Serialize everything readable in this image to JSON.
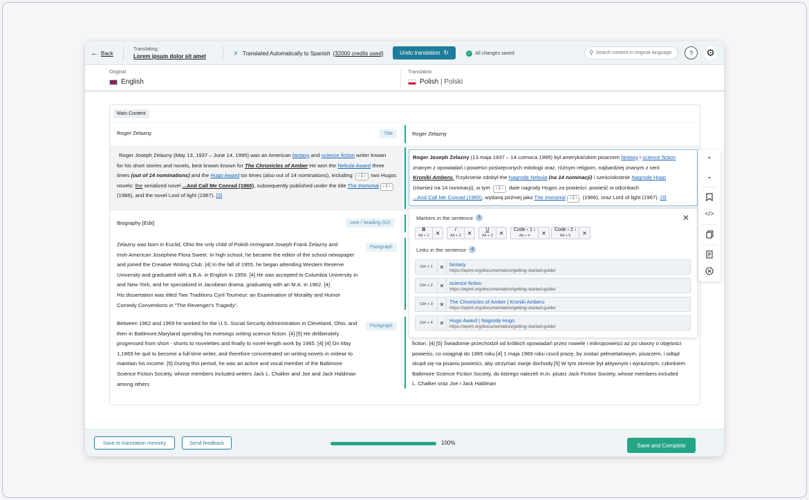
{
  "topbar": {
    "back_label": "Back",
    "translating_label": "Translating:",
    "document_title": "Lorem ipsum dolor sit amet",
    "auto_text": "Translated Automatically to Spanish",
    "credits_text": "(32000 credits used)",
    "undo_label": "Undo translation",
    "saved_text": "All changes saved",
    "search_placeholder": "Search content in original language"
  },
  "languages": {
    "original_caption": "Original",
    "original_name": "English",
    "translation_caption": "Translation",
    "translation_name": "Polish",
    "translation_native": "| Polski"
  },
  "content": {
    "section_tag": "Main Content",
    "title_row": {
      "source": "Roger Zelazny",
      "tag": "Title",
      "target": "Roger Zelazny"
    },
    "para1": {
      "source": {
        "l1_pre": "Roger Joseph Zelazny  (May 13, 1937 – June 14, 1995) was an American ",
        "l1_link1": "fantasy",
        "l1_mid": " and ",
        "l1_link2": "science fiction",
        "l1_post": " writer known",
        "l2_pre": "for his short stories and novels, best known known for ",
        "l2_bold": "The Chronicles of Amber",
        "l2_mid": " He won the ",
        "l2_link": "Nebula Award",
        "l2_post": " three",
        "l3_pre": "times ",
        "l3_bold": "(out of 14 nominations)",
        "l3_mid": " and the ",
        "l3_link": "Hugo Award",
        "l3_post1": " six times (also out of 14 nominations), including ",
        "l3_chip": "‹ 1 ›",
        "l3_post2": " two Hugos",
        "l4_pre": "novels: ",
        "l4_u1": "the",
        "l4_mid": " serialized novel ",
        "l4_bold": "...And Call Me Conrad (1965)",
        "l4_post": ", subsequently published under the title ",
        "l4_link": "The Immortal",
        "l4_chip": "‹ 2 ›",
        "l5_pre": "(1966), and the novel Lord of light (1967). ",
        "l5_ref": "[3]"
      },
      "target": {
        "l1_bold": "Roger Joseph Zelazny",
        "l1_pre": " (13 maja 1937 –  14 czerwca 1995) był amerykańskim pisarzem ",
        "l1_link1": "fantasy",
        "l1_mid": " i ",
        "l1_link2": "science fiction",
        "l2": "znanym z opowiadań i powieści poświęconych mitologii oraz, różnym religiom, najbardziej znanym z serii",
        "l3_bold": "Kroniki Amberu.",
        "l3_pre": " Trzykrotnie zdobył the ",
        "l3_link": "Nagrodę Nebula",
        "l3_bold2": " (na 14 nominacji)",
        "l3_mid": " i sześciokrotnie ",
        "l3_link2": "Nagrodę Hugo",
        "l4_pre": "(również na 14 nominacji), w tym ",
        "l4_chip": "‹ 1 ›",
        "l4_post": " dwie nagrody Hugos za powieści: powieść w odcinkach",
        "l5_link": "...And Call Me Conrad (1965)",
        "l5_mid": ", wydaną później jako ",
        "l5_link2": "The Immortal",
        "l5_chip": "‹ 2 ›",
        "l5_post": " (1966), oraz Lord of light (1967). ",
        "l5_ref": "[3]"
      }
    },
    "heading_row": {
      "source": "Biography [Edit]",
      "tag": "core / heading (h2)"
    },
    "para2": {
      "tag": "Paragraph",
      "lines": [
        "Zelazny was born in  Euclid, Ohio  the only child of  Polish  immigrant Joseph Frank Żelazny and",
        "Irish-American Josephine Flora Sweet. In high school, he became the editor of the school newspaper",
        "and joined the Creative Writing Club. [4] In the fall of 1955, he began attending Western Reserve",
        "University and graduated with a B.A. in English in 1959. [4] He was accepted to Columbia University in",
        "and New York, and he specialized in Jacobean drama, graduating with an M.A. in 1962. [4]",
        "His dissertation was titled Two Traditions Cyril Tourneur: an Examination of Morality and Humor",
        "Comedy Conventions in \"The Revenger's Tragedy\"."
      ]
    },
    "para3": {
      "tag": "Paragraph",
      "lines": [
        "Between 1962 and 1969  he  worked for the U.S.  Social Security Administration  in  Cleveland, Ohio, and",
        "then in Baltimore,Maryland spending his evenings writing science fiction. [4] [5] He deliberately",
        "progressed from short - shorts to novelettes and finally to novel-length work by 1965. [4] [4] On May",
        "1,1969 he quit to become a full-time writer, and therefore concentrated on writing novels in ordewr to",
        "maintain his income. [5] During this period, he was an active and vocal member of the Baltimore",
        "Science Fiction Society, whose members included writers Jack L.  Chalker and Joe and Jack Haldman",
        "among others"
      ],
      "target_lines": [
        "fiction. [4] [5] Świadomie przechodził od krótkich opowiadań przez nowele i mikropowieści aż po utwory o objętości",
        "powieści, co osiągnął do 1965 roku.[4] 1 maja 1969 roku rzucił pracę, by zostać pełnoetatowym, pisarzem, i odtąd",
        "skupił się na pisaniu powieści, aby utrzymać swoje dochody.[5] W tym okresie był aktywnym i wyrazistym, członkiem",
        "Baltimore Science Fiction Society, do którego należeli m.in. pisarz Jack Fiction Society, whose members included",
        "L. Chalker oraz Joe i Jack Haldman"
      ]
    }
  },
  "popup": {
    "markers_title": "Markers in the sentence",
    "markers_count": "5",
    "markers": [
      {
        "label": "B",
        "key": "Alt + 1"
      },
      {
        "label": "I",
        "key": "Alt + 2"
      },
      {
        "label": "U",
        "key": "Alt + 3"
      },
      {
        "label": "Code ‹ 1 ›",
        "key": "Alt + 4"
      },
      {
        "label": "Code ‹ 2 ›",
        "key": "Alt + 5"
      }
    ],
    "links_title": "Links in the sentence",
    "links_count": "4",
    "links": [
      {
        "key": "Ctrl + 1",
        "title": "fantasy",
        "url": "https://wpml.org/documentation/getting-started-guide/"
      },
      {
        "key": "Ctrl + 2",
        "title": "science fiction",
        "url": "https://wpml.org/documentation/getting-started-guide/"
      },
      {
        "key": "Ctrl + 3",
        "title": "The Chronicles of Amber | Kroniki Amberu",
        "url": "https://wpml.org/documentation/getting-started-guide/"
      },
      {
        "key": "Ctrl + 4",
        "title": "Hugo Award | Nagrodę Hugo",
        "url": "https://wpml.org/documentation/getting-started-guide/"
      }
    ]
  },
  "footer": {
    "save_memory_label": "Save to translation memory",
    "feedback_label": "Send feedback",
    "progress_percent": 100,
    "progress_text": "100%",
    "complete_label": "Save and Complete"
  },
  "colors": {
    "accent": "#24a586",
    "primary": "#1e7d9a",
    "link": "#1a63b8"
  }
}
